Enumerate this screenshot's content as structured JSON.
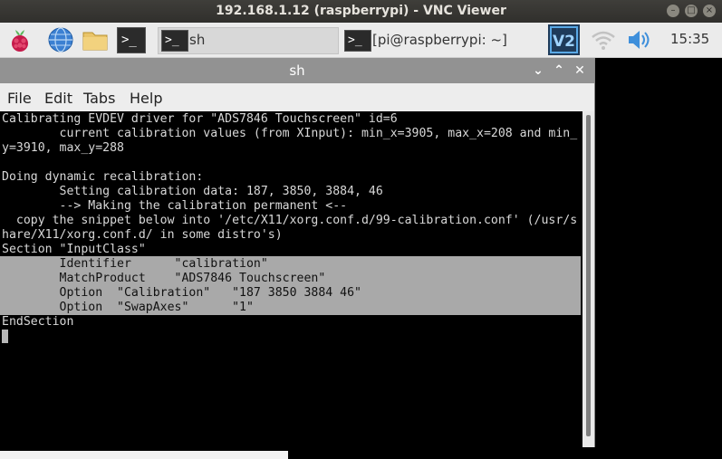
{
  "vnc": {
    "title": "192.168.1.12 (raspberrypi) - VNC Viewer"
  },
  "taskbar": {
    "tasks": [
      {
        "label": "sh"
      },
      {
        "label": "[pi@raspberrypi: ~]"
      }
    ],
    "clock": "15:35",
    "mini_terminal_glyph": ">_"
  },
  "terminal": {
    "title": "sh",
    "menus": [
      "File",
      "Edit",
      "Tabs",
      "Help"
    ],
    "lines": [
      "Calibrating EVDEV driver for \"ADS7846 Touchscreen\" id=6",
      "        current calibration values (from XInput): min_x=3905, max_x=208 and min_",
      "y=3910, max_y=288",
      "",
      "Doing dynamic recalibration:",
      "        Setting calibration data: 187, 3850, 3884, 46",
      "        --> Making the calibration permanent <--",
      "  copy the snippet below into '/etc/X11/xorg.conf.d/99-calibration.conf' (/usr/s",
      "hare/X11/xorg.conf.d/ in some distro's)",
      "Section \"InputClass\""
    ],
    "selected_lines": [
      "        Identifier      \"calibration\"",
      "        MatchProduct    \"ADS7846 Touchscreen\"",
      "        Option  \"Calibration\"   \"187 3850 3884 46\"",
      "        Option  \"SwapAxes\"      \"1\""
    ],
    "end_line": "EndSection"
  }
}
